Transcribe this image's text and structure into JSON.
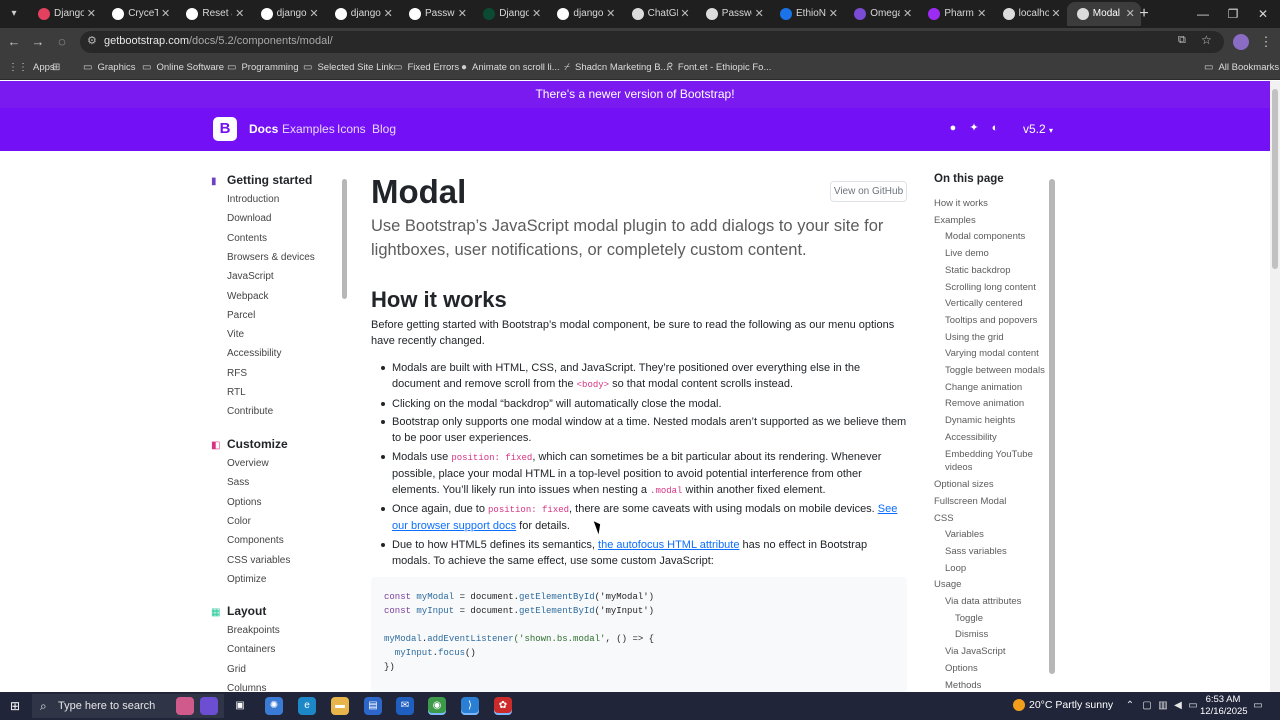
{
  "browser": {
    "tabs": [
      {
        "title": "Django",
        "color": "#e4405f"
      },
      {
        "title": "CryceTr",
        "color": "#ffffff"
      },
      {
        "title": "Reset a",
        "color": "#ffffff"
      },
      {
        "title": "django",
        "color": "#ffffff"
      },
      {
        "title": "django",
        "color": "#ffffff"
      },
      {
        "title": "Passwo",
        "color": "#ffffff"
      },
      {
        "title": "Django",
        "color": "#0c4b33"
      },
      {
        "title": "django",
        "color": "#ffffff"
      },
      {
        "title": "ChatGP",
        "color": "#dcdcdc"
      },
      {
        "title": "Passwo",
        "color": "#dcdcdc"
      },
      {
        "title": "EthioNe",
        "color": "#1a73e8"
      },
      {
        "title": "Omega",
        "color": "#7b4bd6"
      },
      {
        "title": "Pharma",
        "color": "#9c2cf3"
      },
      {
        "title": "localho",
        "color": "#dcdcdc"
      },
      {
        "title": "Modal",
        "color": "#dcdcdc",
        "active": true
      }
    ],
    "url_host": "getbootstrap.com",
    "url_path": "/docs/5.2/components/modal/",
    "bookmarks": [
      {
        "label": "Apps",
        "icon": "apps-icon"
      },
      {
        "label": "",
        "icon": "grid-icon"
      },
      {
        "label": "Graphics",
        "icon": "folder-icon"
      },
      {
        "label": "Online Software",
        "icon": "folder-icon"
      },
      {
        "label": "Programming",
        "icon": "folder-icon"
      },
      {
        "label": "Selected Site Link",
        "icon": "folder-icon"
      },
      {
        "label": "Fixed Errors",
        "icon": "folder-icon"
      },
      {
        "label": "Animate on scroll li...",
        "icon": "github-icon"
      },
      {
        "label": "Shadcn Marketing B...",
        "icon": "shadcn-icon"
      },
      {
        "label": "Font.et - Ethiopic Fo...",
        "icon": "font-icon"
      }
    ],
    "all_bookmarks": "All Bookmarks"
  },
  "site": {
    "banner": "There's a newer version of Bootstrap!",
    "brand": "B",
    "nav": [
      "Docs",
      "Examples",
      "Icons",
      "Blog"
    ],
    "version": "v5.2"
  },
  "sidebar": {
    "sections": [
      {
        "title": "Getting started",
        "color": "#6f42c1",
        "items": [
          "Introduction",
          "Download",
          "Contents",
          "Browsers & devices",
          "JavaScript",
          "Webpack",
          "Parcel",
          "Vite",
          "Accessibility",
          "RFS",
          "RTL",
          "Contribute"
        ]
      },
      {
        "title": "Customize",
        "color": "#d63384",
        "items": [
          "Overview",
          "Sass",
          "Options",
          "Color",
          "Components",
          "CSS variables",
          "Optimize"
        ]
      },
      {
        "title": "Layout",
        "color": "#20c997",
        "items": [
          "Breakpoints",
          "Containers",
          "Grid",
          "Columns"
        ]
      }
    ]
  },
  "main": {
    "title": "Modal",
    "github_button": "View on GitHub",
    "lead": "Use Bootstrap’s JavaScript modal plugin to add dialogs to your site for lightboxes, user notifications, or completely custom content.",
    "section_title": "How it works",
    "intro": "Before getting started with Bootstrap’s modal component, be sure to read the following as our menu options have recently changed.",
    "b1a": "Modals are built with HTML, CSS, and JavaScript. They’re positioned over everything else in the document and remove scroll from the ",
    "b1code": "<body>",
    "b1b": " so that modal content scrolls instead.",
    "b2": "Clicking on the modal “backdrop” will automatically close the modal.",
    "b3": "Bootstrap only supports one modal window at a time. Nested modals aren’t supported as we believe them to be poor user experiences.",
    "b4a": "Modals use ",
    "b4code": "position: fixed",
    "b4b": ", which can sometimes be a bit particular about its rendering. Whenever possible, place your modal HTML in a top-level position to avoid potential interference from other elements. You’ll likely run into issues when nesting a ",
    "b4code2": ".modal",
    "b4c": " within another fixed element.",
    "b5a": "Once again, due to ",
    "b5code": "position: fixed",
    "b5b": ", there are some caveats with using modals on mobile devices. ",
    "b5link": "See our browser support docs",
    "b5c": " for details.",
    "b6a": "Due to how HTML5 defines its semantics, ",
    "b6link": "the autofocus HTML attribute",
    "b6b": " has no effect in Bootstrap modals. To achieve the same effect, use some custom JavaScript:",
    "code": {
      "l1_kw": "const ",
      "l1_var": "myModal",
      "l1_mid": " = document.",
      "l1_fn": "getElementById",
      "l1_arg": "('myModal')",
      "l2_kw": "const ",
      "l2_var": "myInput",
      "l2_mid": " = document.",
      "l2_fn": "getElementById",
      "l2_arg": "('myInput')",
      "l3_var": "myModal",
      "l3_mid": ".",
      "l3_fn": "addEventListener",
      "l3_str": "('shown.bs.modal'",
      "l3_rest": ", () => {",
      "l4_var": "  myInput",
      "l4_mid": ".",
      "l4_fn": "focus",
      "l4_rest": "()",
      "l5": "})"
    }
  },
  "toc": {
    "title": "On this page",
    "items": [
      {
        "label": "How it works",
        "level": 0
      },
      {
        "label": "Examples",
        "level": 0
      },
      {
        "label": "Modal components",
        "level": 1
      },
      {
        "label": "Live demo",
        "level": 1
      },
      {
        "label": "Static backdrop",
        "level": 1
      },
      {
        "label": "Scrolling long content",
        "level": 1
      },
      {
        "label": "Vertically centered",
        "level": 1
      },
      {
        "label": "Tooltips and popovers",
        "level": 1
      },
      {
        "label": "Using the grid",
        "level": 1
      },
      {
        "label": "Varying modal content",
        "level": 1
      },
      {
        "label": "Toggle between modals",
        "level": 1
      },
      {
        "label": "Change animation",
        "level": 1
      },
      {
        "label": "Remove animation",
        "level": 1
      },
      {
        "label": "Dynamic heights",
        "level": 1
      },
      {
        "label": "Accessibility",
        "level": 1
      },
      {
        "label": "Embedding YouTube videos",
        "level": 1
      },
      {
        "label": "Optional sizes",
        "level": 0
      },
      {
        "label": "Fullscreen Modal",
        "level": 0
      },
      {
        "label": "CSS",
        "level": 0
      },
      {
        "label": "Variables",
        "level": 1
      },
      {
        "label": "Sass variables",
        "level": 1
      },
      {
        "label": "Loop",
        "level": 1
      },
      {
        "label": "Usage",
        "level": 0
      },
      {
        "label": "Via data attributes",
        "level": 1
      },
      {
        "label": "Toggle",
        "level": 2
      },
      {
        "label": "Dismiss",
        "level": 2
      },
      {
        "label": "Via JavaScript",
        "level": 1
      },
      {
        "label": "Options",
        "level": 1
      },
      {
        "label": "Methods",
        "level": 1
      }
    ]
  },
  "taskbar": {
    "search_placeholder": "Type here to search",
    "weather": "20°C  Partly sunny",
    "time": "6:53 AM",
    "date": "12/16/2025"
  }
}
